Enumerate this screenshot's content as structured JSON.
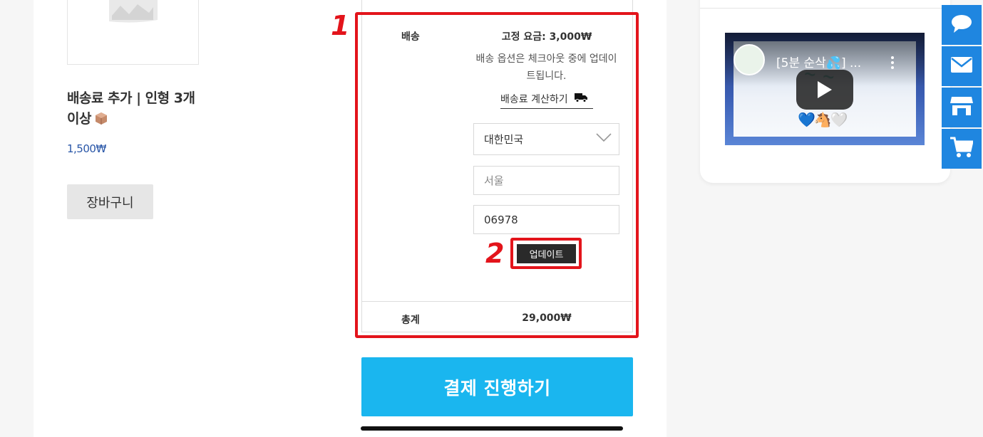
{
  "product": {
    "title": "배송료 추가 | 인형 3개 이상",
    "price": "1,500₩",
    "cart_button": "장바구니"
  },
  "shipping": {
    "label": "배송",
    "fixed_rate": "고정 요금: 3,000₩",
    "note": "배송 옵션은 체크아웃 중에 업데이트됩니다.",
    "calc_link": "배송료 계산하기",
    "country_value": "대한민국",
    "city_placeholder": "서울",
    "postal_value": "06978",
    "update_button": "업데이트"
  },
  "total": {
    "label": "총계",
    "value": "29,000₩"
  },
  "annotations": {
    "marker_1": "1",
    "marker_2": "2",
    "color": "#e3141b"
  },
  "checkout": {
    "button": "결제 진행하기",
    "color": "#1ab6ef"
  },
  "video": {
    "title": "[5분 순삭💦] ...",
    "emoji": "💙🐴🤍"
  },
  "side_bar": {
    "icons": [
      "chat-icon",
      "mail-icon",
      "store-icon",
      "cart-icon"
    ],
    "color": "#1f86e0"
  }
}
